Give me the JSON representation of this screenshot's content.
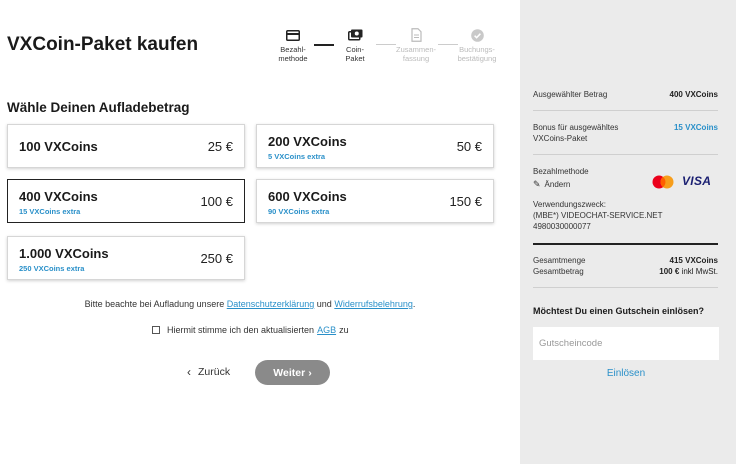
{
  "page": {
    "title": "VXCoin-Paket kaufen"
  },
  "stepper": [
    {
      "label": "Bezahl-\nmethode",
      "icon": "credit-card-icon",
      "active": true
    },
    {
      "label": "Coin-\nPaket",
      "icon": "coin-icon",
      "active": true
    },
    {
      "label": "Zusammen-\nfassung",
      "icon": "document-icon",
      "active": false
    },
    {
      "label": "Buchungs-\nbestätigung",
      "icon": "check-circle-icon",
      "active": false
    }
  ],
  "section": {
    "title": "Wähle Deinen Aufladebetrag"
  },
  "packages": [
    {
      "name": "100 VXCoins",
      "extra": "",
      "price": "25 €"
    },
    {
      "name": "200 VXCoins",
      "extra": "5 VXCoins extra",
      "price": "50 €"
    },
    {
      "name": "400 VXCoins",
      "extra": "15 VXCoins extra",
      "price": "100 €"
    },
    {
      "name": "600 VXCoins",
      "extra": "90 VXCoins extra",
      "price": "150 €"
    },
    {
      "name": "1.000 VXCoins",
      "extra": "250 VXCoins extra",
      "price": "250 €"
    }
  ],
  "notice": {
    "prefix": "Bitte beachte bei Aufladung unsere",
    "privacy_link": "Datenschutzerklärung",
    "and": "und",
    "withdrawal_link": "Widerrufsbelehrung",
    "suffix": "."
  },
  "agb": {
    "prefix": "Hiermit stimme ich den aktualisierten",
    "link": "AGB",
    "suffix": "zu"
  },
  "nav": {
    "back_label": "Zurück",
    "next_label": "Weiter"
  },
  "summary": {
    "selected_amount_label": "Ausgewählter Betrag",
    "selected_amount_value": "400 VXCoins",
    "bonus_label": "Bonus für ausgewähltes VXCoins-Paket",
    "bonus_value": "15 VXCoins",
    "payment_label": "Bezahlmethode",
    "change_label": "Ändern",
    "card_brand": "VISA",
    "purpose_label": "Verwendungszweck:",
    "purpose_value": "(MBE*) VIDEOCHAT-SERVICE.NET 4980030000077",
    "total_amount_label": "Gesamtmenge",
    "total_amount_value": "415 VXCoins",
    "total_price_label": "Gesamtbetrag",
    "total_price_value": "100 €",
    "total_price_suffix": "inkl MwSt."
  },
  "voucher": {
    "title": "Möchtest Du einen Gutschein einlösen?",
    "placeholder": "Gutscheincode",
    "redeem_label": "Einlösen"
  },
  "colors": {
    "accent": "#2a90c9",
    "sidebar_bg": "#ebebeb",
    "button_disabled": "#8a8a8a"
  }
}
